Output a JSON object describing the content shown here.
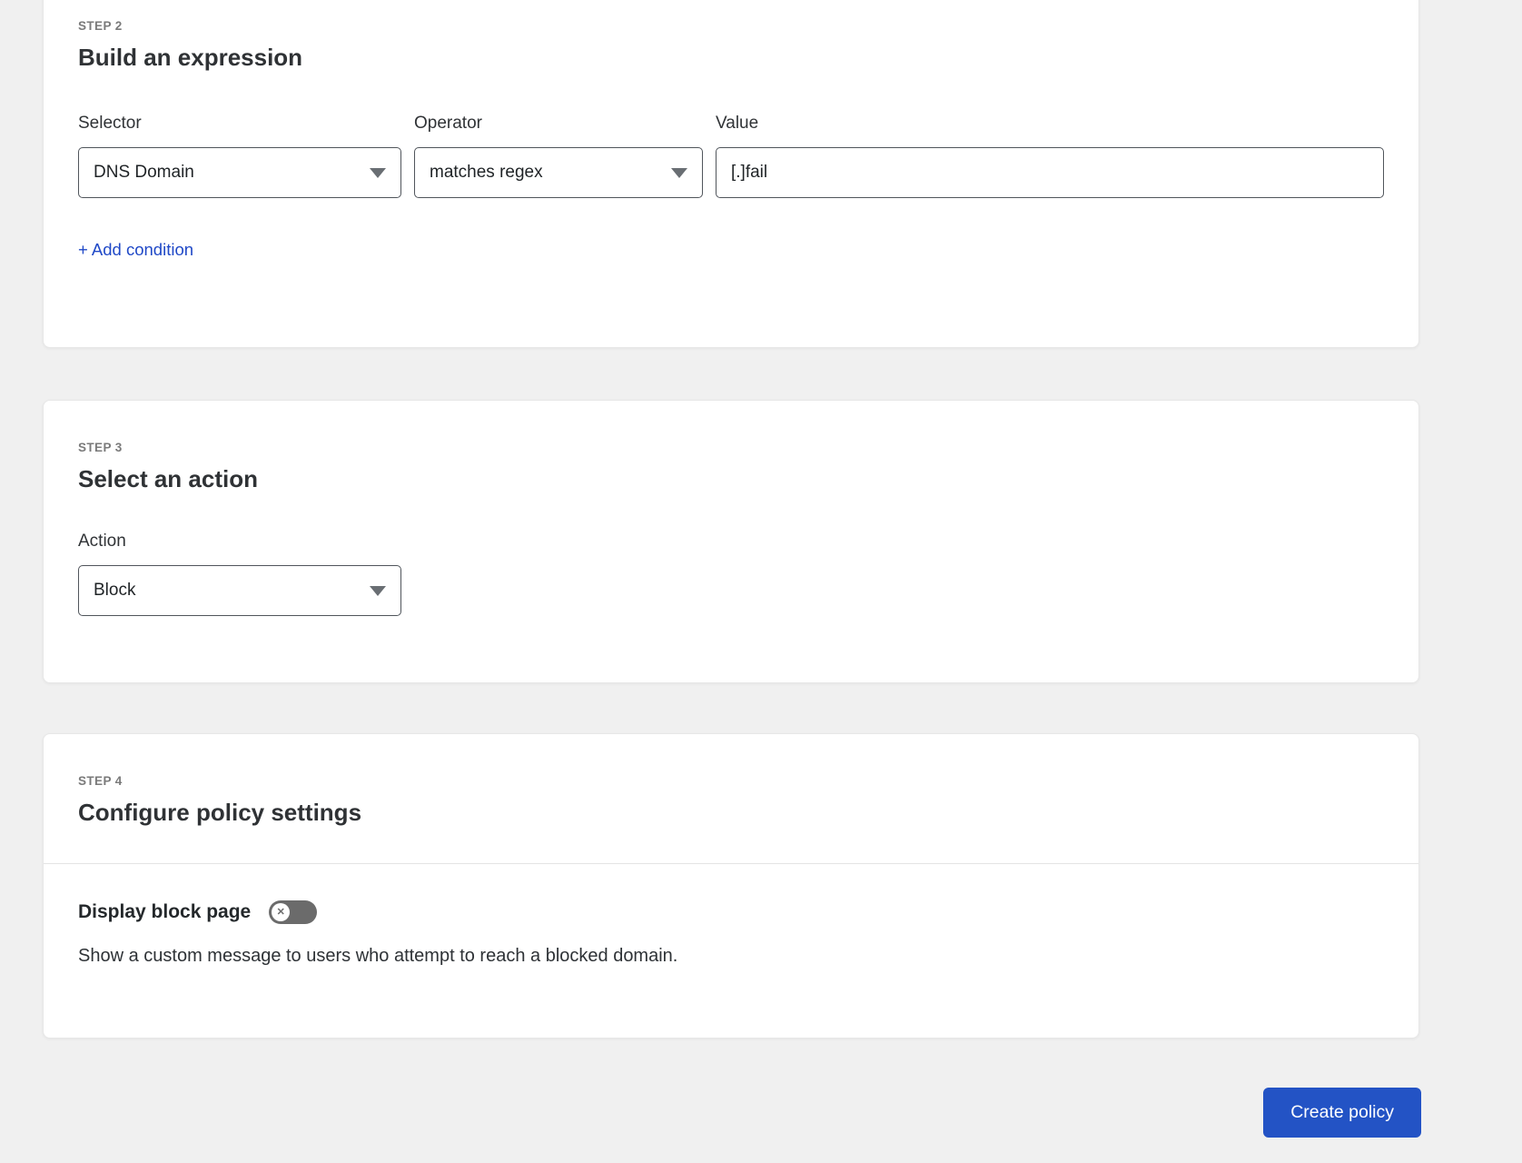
{
  "theme": {
    "background": "#f0f0f0",
    "card_background": "#ffffff",
    "accent_blue": "#2353c5",
    "link_blue": "#2049c7",
    "toggle_off_gray": "#6b6b6b",
    "step_label_gray": "#7a7a7a"
  },
  "icons": {
    "dropdown_caret": "▾",
    "toggle_off_x": "✕"
  },
  "step2": {
    "step_label": "STEP 2",
    "title": "Build an expression",
    "selector": {
      "label": "Selector",
      "value": "DNS Domain"
    },
    "operator": {
      "label": "Operator",
      "value": "matches regex"
    },
    "value_field": {
      "label": "Value",
      "value": "[.]fail"
    },
    "add_condition_label": "+ Add condition"
  },
  "step3": {
    "step_label": "STEP 3",
    "title": "Select an action",
    "action": {
      "label": "Action",
      "value": "Block"
    }
  },
  "step4": {
    "step_label": "STEP 4",
    "title": "Configure policy settings",
    "display_block_page": {
      "label": "Display block page",
      "enabled": false,
      "description": "Show a custom message to users who attempt to reach a blocked domain."
    }
  },
  "footer": {
    "create_policy_label": "Create policy"
  }
}
